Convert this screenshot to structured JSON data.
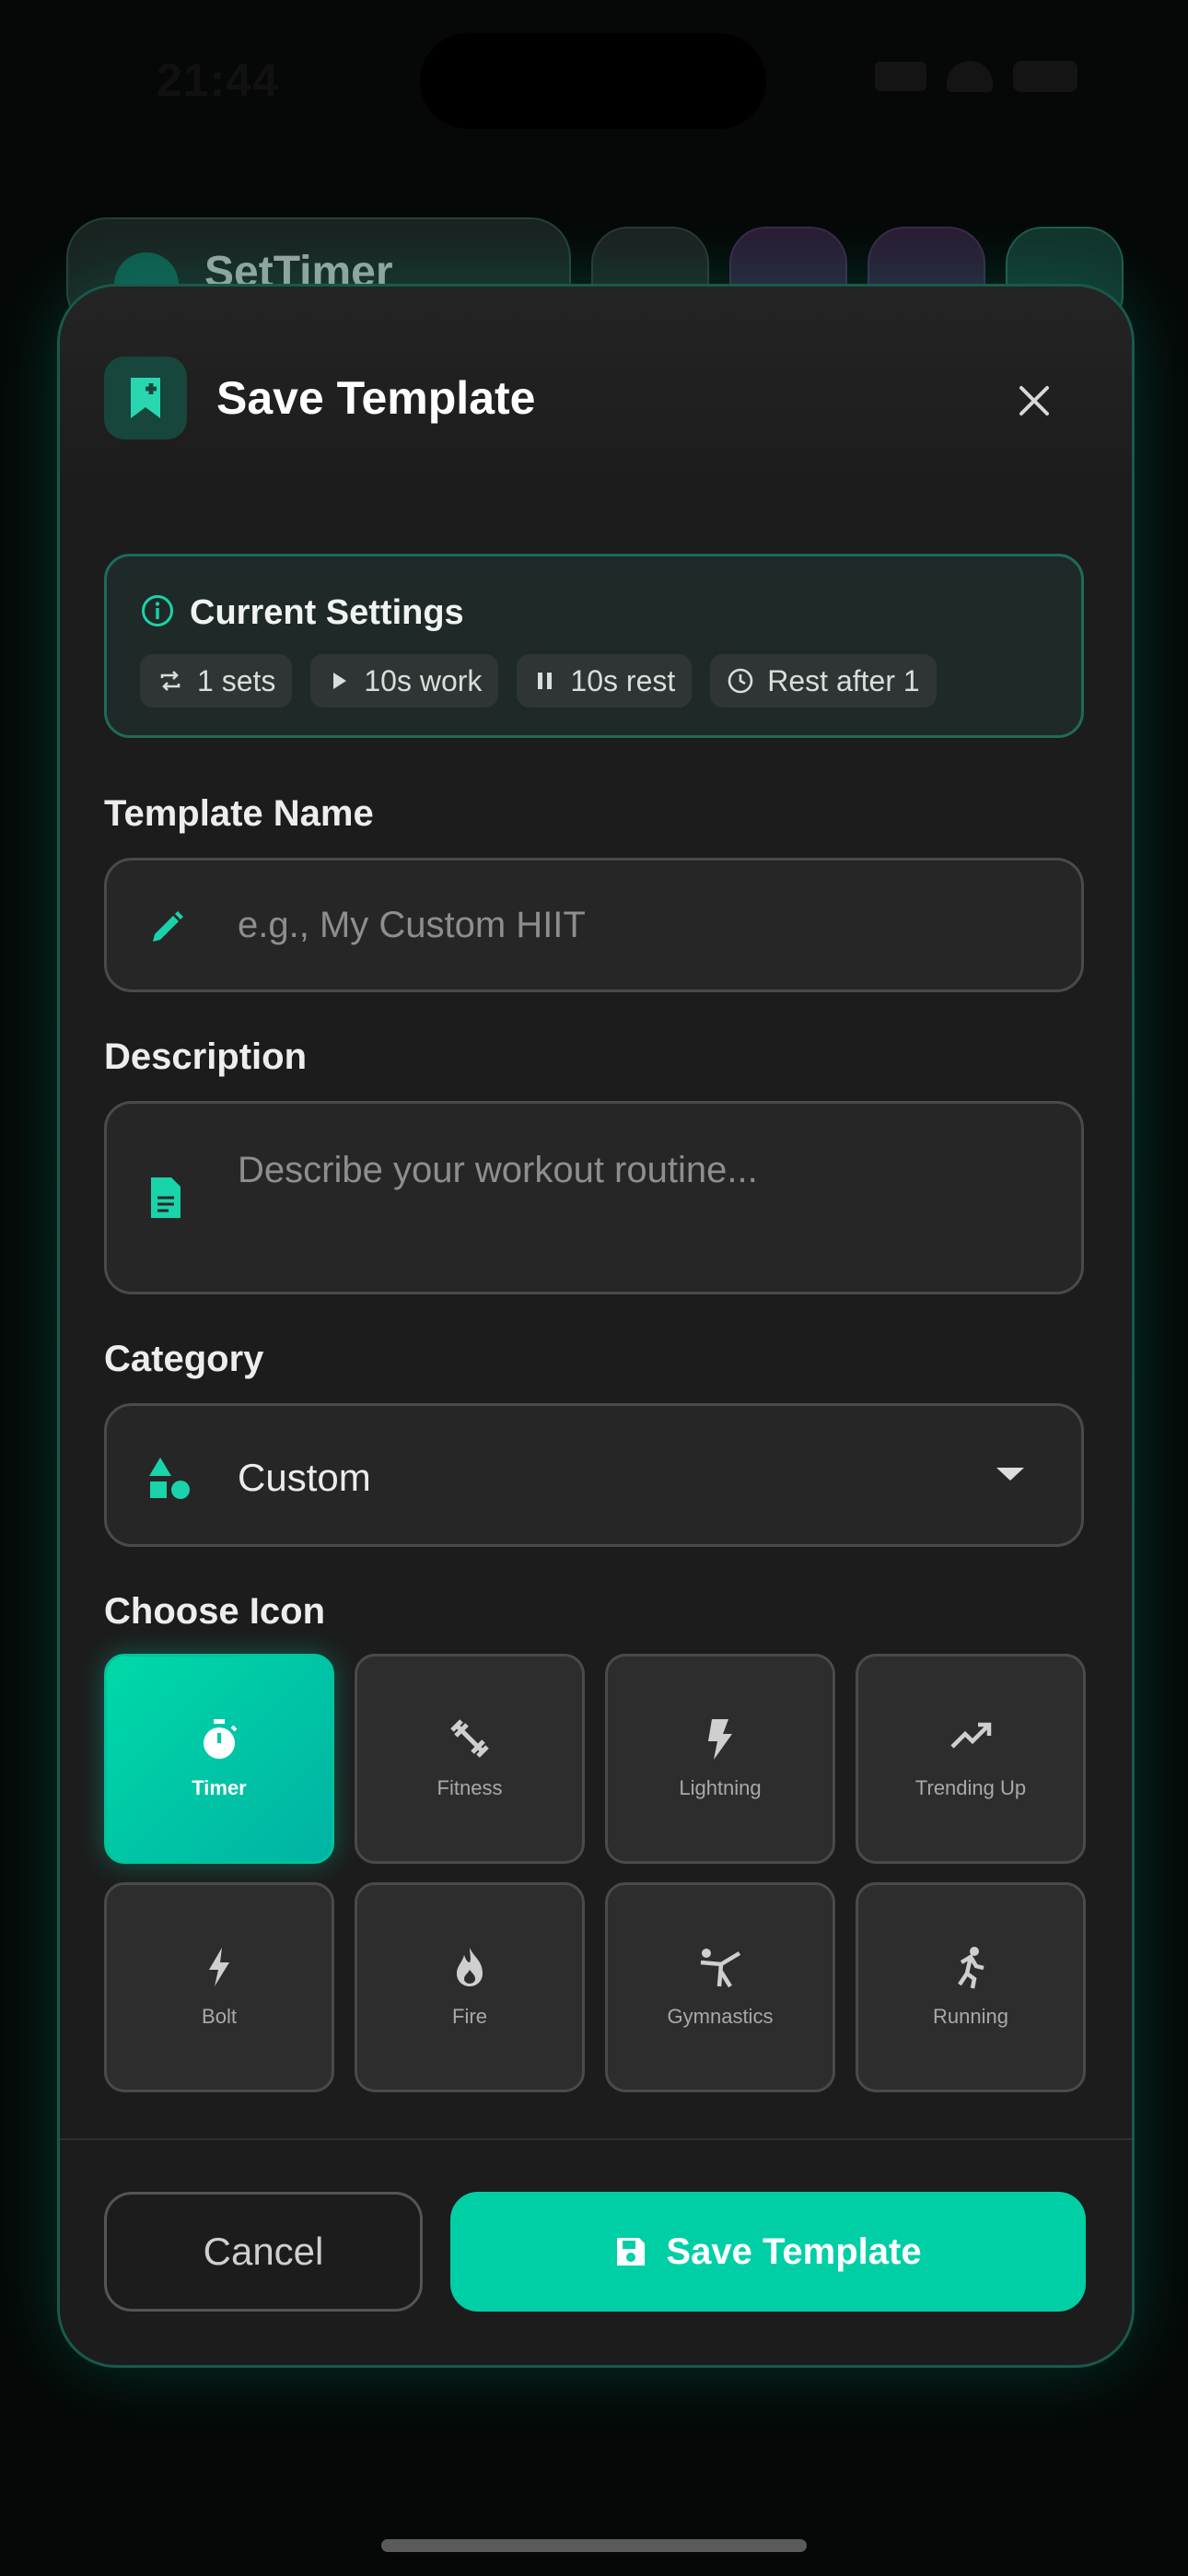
{
  "status": {
    "time": "21:44"
  },
  "app": {
    "title": "SetTimer"
  },
  "modal": {
    "title": "Save Template",
    "close_label": "close"
  },
  "settings": {
    "title": "Current Settings",
    "chips": [
      {
        "icon": "repeat-icon",
        "label": "1 sets"
      },
      {
        "icon": "play-icon",
        "label": "10s work"
      },
      {
        "icon": "pause-icon",
        "label": "10s rest"
      },
      {
        "icon": "clock-icon",
        "label": "Rest after 1"
      }
    ]
  },
  "template_name": {
    "label": "Template Name",
    "placeholder": "e.g., My Custom HIIT",
    "value": ""
  },
  "description": {
    "label": "Description",
    "placeholder": "Describe your workout routine...",
    "value": ""
  },
  "category": {
    "label": "Category",
    "value": "Custom"
  },
  "icons": {
    "label": "Choose Icon",
    "selected": "Timer",
    "items": [
      {
        "name": "timer-icon",
        "label": "Timer"
      },
      {
        "name": "fitness-icon",
        "label": "Fitness"
      },
      {
        "name": "lightning-icon",
        "label": "Lightning"
      },
      {
        "name": "trending-up-icon",
        "label": "Trending Up"
      },
      {
        "name": "bolt-icon",
        "label": "Bolt"
      },
      {
        "name": "fire-icon",
        "label": "Fire"
      },
      {
        "name": "gymnastics-icon",
        "label": "Gymnastics"
      },
      {
        "name": "running-icon",
        "label": "Running"
      }
    ]
  },
  "actions": {
    "cancel_label": "Cancel",
    "save_label": "Save Template"
  },
  "colors": {
    "accent": "#00cfa6",
    "modal_bg": "#1c1c1c",
    "border": "#175a4b"
  }
}
